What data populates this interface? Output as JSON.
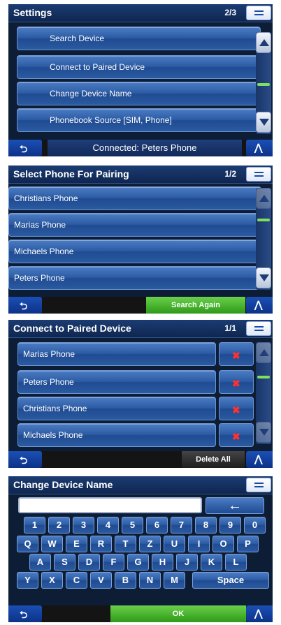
{
  "icons": {
    "menu": "menu-grid-icon",
    "back": "back-arrow-icon",
    "up": "chevron-up-icon",
    "delete": "delete-x-icon",
    "backspace": "backspace-arrow-icon"
  },
  "colors": {
    "accent_blue": "#2c5ba3",
    "ok_green": "#3aa323",
    "delete_red": "#ff3030",
    "scroll_thumb": "#7ee060"
  },
  "settings": {
    "title": "Settings",
    "page": "2/3",
    "items": [
      {
        "label": "Search Device"
      },
      {
        "label": "Connect to Paired Device"
      },
      {
        "label": "Change Device Name"
      },
      {
        "label": "Phonebook Source [SIM, Phone]"
      }
    ],
    "status": "Connected: Peters Phone"
  },
  "pairing": {
    "title": "Select Phone For Pairing",
    "page": "1/2",
    "items": [
      {
        "label": "Christians Phone"
      },
      {
        "label": "Marias Phone"
      },
      {
        "label": "Michaels Phone"
      },
      {
        "label": "Peters Phone"
      }
    ],
    "search_again": "Search Again"
  },
  "paired": {
    "title": "Connect to Paired Device",
    "page": "1/1",
    "items": [
      {
        "label": "Marias Phone"
      },
      {
        "label": "Peters Phone"
      },
      {
        "label": "Christians Phone"
      },
      {
        "label": "Michaels Phone"
      }
    ],
    "delete_all": "Delete All"
  },
  "rename": {
    "title": "Change Device Name",
    "input_value": "",
    "backspace": "←",
    "rows": [
      [
        "1",
        "2",
        "3",
        "4",
        "5",
        "6",
        "7",
        "8",
        "9",
        "0"
      ],
      [
        "Q",
        "W",
        "E",
        "R",
        "T",
        "Z",
        "U",
        "I",
        "O",
        "P"
      ],
      [
        "A",
        "S",
        "D",
        "F",
        "G",
        "H",
        "J",
        "K",
        "L"
      ],
      [
        "Y",
        "X",
        "C",
        "V",
        "B",
        "N",
        "M"
      ]
    ],
    "space": "Space",
    "ok": "OK"
  },
  "glyphs": {
    "back": "⮌",
    "up": "⋀",
    "delete": "✖"
  }
}
